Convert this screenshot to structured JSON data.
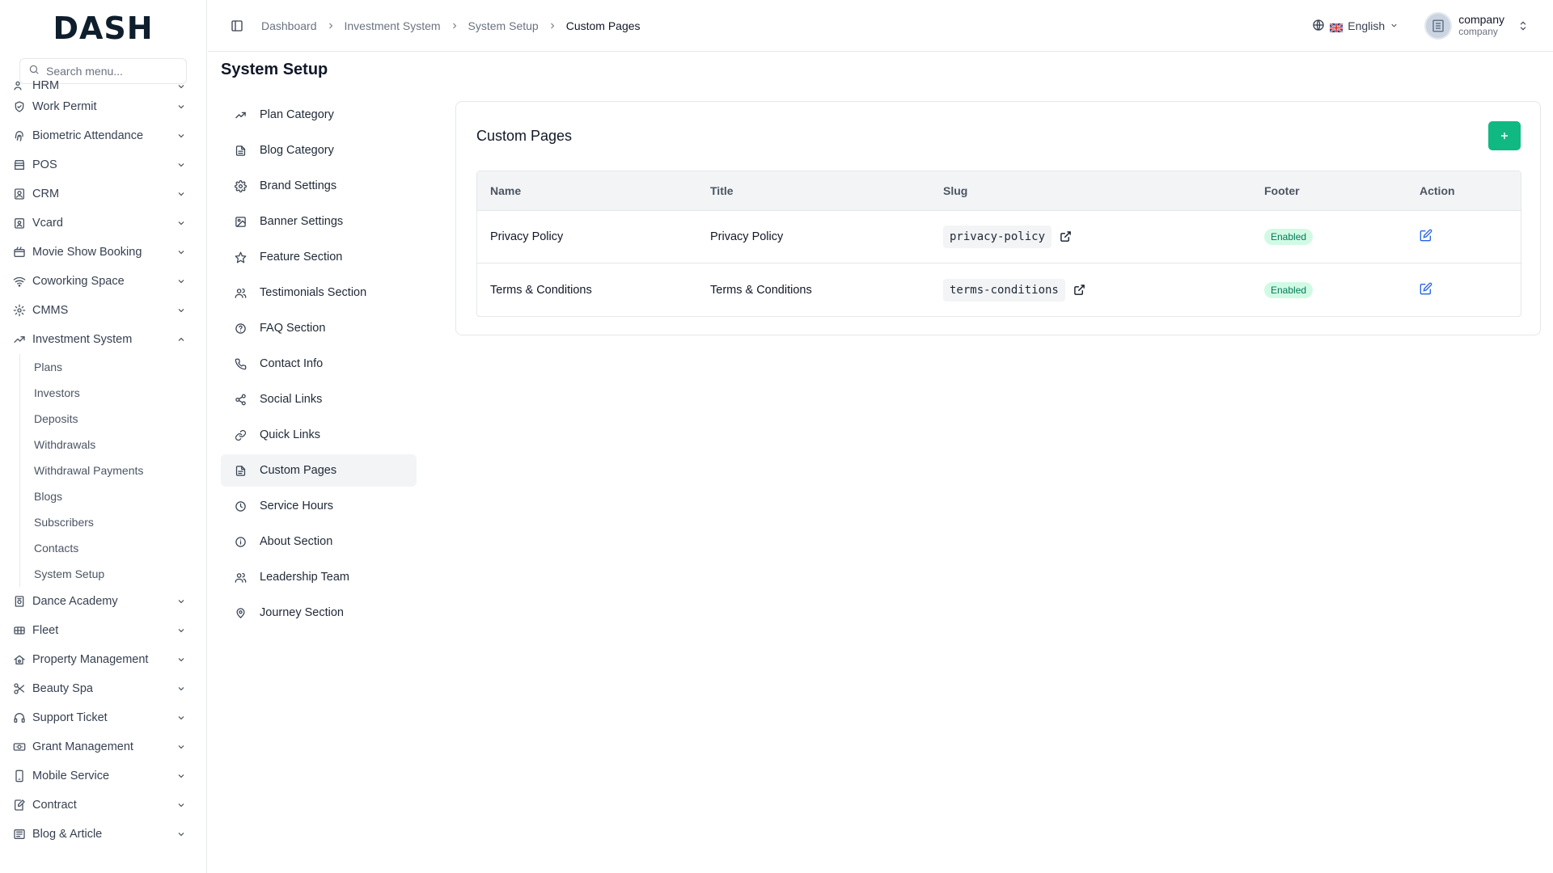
{
  "app": {
    "logo": "DASH"
  },
  "search": {
    "placeholder": "Search menu..."
  },
  "sidebar": {
    "partial_label": "HRM",
    "items_top": [
      {
        "label": "Work Permit",
        "icon": "shield-icon"
      },
      {
        "label": "Biometric Attendance",
        "icon": "fingerprint-icon"
      },
      {
        "label": "POS",
        "icon": "store-icon"
      },
      {
        "label": "CRM",
        "icon": "contact-icon"
      },
      {
        "label": "Vcard",
        "icon": "id-card-icon"
      },
      {
        "label": "Movie Show Booking",
        "icon": "ticket-icon"
      },
      {
        "label": "Coworking Space",
        "icon": "wifi-icon"
      },
      {
        "label": "CMMS",
        "icon": "cog-icon"
      },
      {
        "label": "Investment System",
        "icon": "trending-up-icon"
      }
    ],
    "investment_sub": [
      "Plans",
      "Investors",
      "Deposits",
      "Withdrawals",
      "Withdrawal Payments",
      "Blogs",
      "Subscribers",
      "Contacts",
      "System Setup"
    ],
    "items_bottom": [
      {
        "label": "Dance Academy",
        "icon": "building-icon"
      },
      {
        "label": "Fleet",
        "icon": "truck-icon"
      },
      {
        "label": "Property Management",
        "icon": "home-icon"
      },
      {
        "label": "Beauty Spa",
        "icon": "scissors-icon"
      },
      {
        "label": "Support Ticket",
        "icon": "headphones-icon"
      },
      {
        "label": "Grant Management",
        "icon": "banknote-icon"
      },
      {
        "label": "Mobile Service",
        "icon": "smartphone-icon"
      },
      {
        "label": "Contract",
        "icon": "file-pen-icon"
      },
      {
        "label": "Blog & Article",
        "icon": "newspaper-icon"
      }
    ]
  },
  "header": {
    "breadcrumbs": [
      "Dashboard",
      "Investment System",
      "System Setup",
      "Custom Pages"
    ],
    "language": "English",
    "user": {
      "name": "company",
      "role": "company"
    }
  },
  "page": {
    "title": "System Setup"
  },
  "setup_menu": [
    {
      "label": "Plan Category",
      "icon": "trending-up-icon"
    },
    {
      "label": "Blog Category",
      "icon": "file-text-icon"
    },
    {
      "label": "Brand Settings",
      "icon": "settings-icon"
    },
    {
      "label": "Banner Settings",
      "icon": "image-icon"
    },
    {
      "label": "Feature Section",
      "icon": "star-icon"
    },
    {
      "label": "Testimonials Section",
      "icon": "users-icon"
    },
    {
      "label": "FAQ Section",
      "icon": "help-circle-icon"
    },
    {
      "label": "Contact Info",
      "icon": "phone-icon"
    },
    {
      "label": "Social Links",
      "icon": "share-icon"
    },
    {
      "label": "Quick Links",
      "icon": "link-icon"
    },
    {
      "label": "Custom Pages",
      "icon": "file-icon",
      "active": true
    },
    {
      "label": "Service Hours",
      "icon": "clock-icon"
    },
    {
      "label": "About Section",
      "icon": "info-icon"
    },
    {
      "label": "Leadership Team",
      "icon": "users-icon"
    },
    {
      "label": "Journey Section",
      "icon": "map-pin-icon"
    }
  ],
  "card": {
    "title": "Custom Pages",
    "columns": [
      "Name",
      "Title",
      "Slug",
      "Footer",
      "Action"
    ],
    "rows": [
      {
        "name": "Privacy Policy",
        "title": "Privacy Policy",
        "slug": "privacy-policy",
        "footer": "Enabled"
      },
      {
        "name": "Terms & Conditions",
        "title": "Terms & Conditions",
        "slug": "terms-conditions",
        "footer": "Enabled"
      }
    ]
  },
  "colors": {
    "accent": "#10b981",
    "badge_bg": "#d1fae5",
    "badge_text": "#047857",
    "edit": "#2563eb"
  }
}
